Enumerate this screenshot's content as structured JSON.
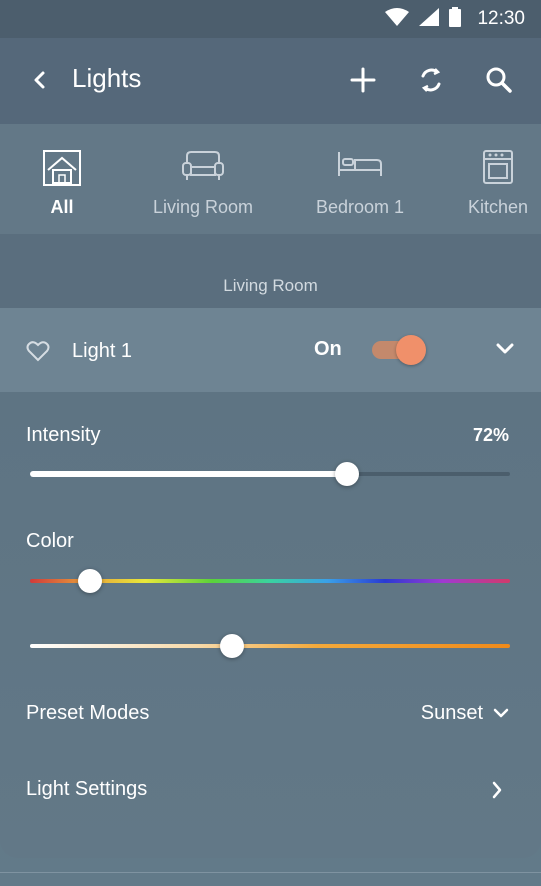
{
  "status": {
    "time": "12:30"
  },
  "appbar": {
    "title": "Lights"
  },
  "categories": [
    {
      "label": "All",
      "icon": "house-icon",
      "active": true
    },
    {
      "label": "Living Room",
      "icon": "sofa-icon",
      "active": false
    },
    {
      "label": "Bedroom 1",
      "icon": "bed-icon",
      "active": false
    },
    {
      "label": "Kitchen",
      "icon": "oven-icon",
      "active": false
    }
  ],
  "section": {
    "title": "Living Room"
  },
  "light": {
    "name": "Light 1",
    "state_label": "On",
    "on": true
  },
  "controls": {
    "intensity_label": "Intensity",
    "intensity_value": "72%",
    "intensity_level": 0.66,
    "color_label": "Color",
    "color_level": 0.125,
    "temperature_level": 0.42,
    "preset_label": "Preset Modes",
    "preset_value": "Sunset",
    "settings_label": "Light Settings"
  },
  "colors": {
    "accent": "#f0906a",
    "header": "#55687a",
    "row_highlight": "#6e8493"
  }
}
